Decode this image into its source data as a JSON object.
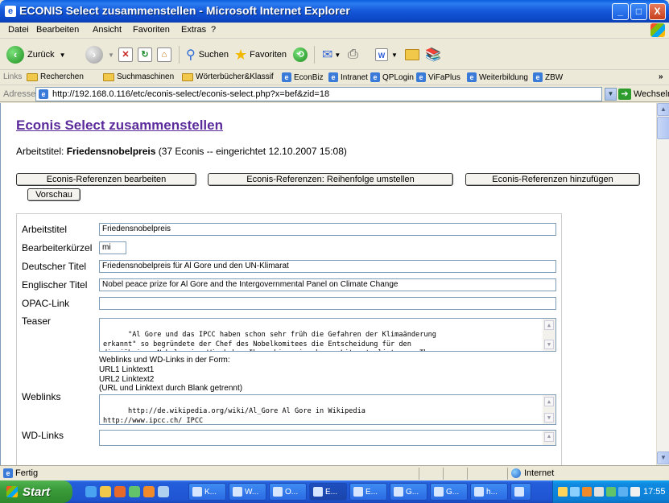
{
  "window": {
    "title": "ECONIS Select zusammenstellen - Microsoft Internet Explorer",
    "min": "_",
    "max": "□",
    "close": "X"
  },
  "menu": [
    "Datei",
    "Bearbeiten",
    "Ansicht",
    "Favoriten",
    "Extras",
    "?"
  ],
  "toolbar": {
    "back": "Zurück",
    "search": "Suchen",
    "favorites": "Favoriten"
  },
  "links": {
    "label": "Links",
    "items": [
      "Recherchen",
      "Suchmaschinen",
      "Wörterbücher&Klassif",
      "EconBiz",
      "Intranet",
      "QPLogin",
      "ViFaPlus",
      "Weiterbildung",
      "ZBW"
    ],
    "more": "»"
  },
  "address": {
    "label": "Adresse",
    "url": "http://192.168.0.116/etc/econis-select/econis-select.php?x=bef&zid=18",
    "go": "Wechseln zu"
  },
  "page": {
    "title": "Econis Select zusammenstellen",
    "worktitle_prefix": "Arbeitstitel: ",
    "worktitle_bold": "Friedensnobelpreis",
    "worktitle_suffix": " (37 Econis -- eingerichtet 12.10.2007 15:08)",
    "buttons": {
      "edit": "Econis-Referenzen bearbeiten",
      "reorder": "Econis-Referenzen: Reihenfolge umstellen",
      "add": "Econis-Referenzen hinzufügen",
      "preview": "Vorschau"
    }
  },
  "form": {
    "arbeitstitel_label": "Arbeitstitel",
    "arbeitstitel_value": "Friedensnobelpreis",
    "kuerzel_label": "Bearbeiterkürzel",
    "kuerzel_value": "mi",
    "de_title_label": "Deutscher Titel",
    "de_title_value": "Friedensnobelpreis für Al Gore und den UN-Klimarat",
    "en_title_label": "Englischer Titel",
    "en_title_value": "Nobel peace prize for Al Gore and the Intergovernmental Panel on Climate Change",
    "opac_label": "OPAC-Link",
    "opac_value": "",
    "teaser_label": "Teaser",
    "teaser_value": "\"Al Gore und das IPCC haben schon sehr früh die Gefahren der Klimaänderung\nerkannt\" so begründete der Chef des Nobelkomitees die Entscheidung für den\ndiesjährigen Nobelpreis. Wir haben Ihnen hier eine kurze Literaturliste zum Thema\naus der Datenbank ECONIS zusammengestellt:",
    "hint_lines": [
      "Weblinks und WD-Links in der Form:",
      "URL1 Linktext1",
      "URL2 Linktext2",
      "(URL und Linktext durch Blank getrennt)"
    ],
    "weblinks_label": "Weblinks",
    "weblinks_value": "http://de.wikipedia.org/wiki/Al_Gore Al Gore in Wikipedia\nhttp://www.ipcc.ch/ IPCC",
    "wdlinks_label": "WD-Links"
  },
  "status": {
    "left": "Fertig",
    "zone": "Internet"
  },
  "taskbar": {
    "start": "Start",
    "tasks": [
      "K...",
      "W...",
      "O...",
      "E...",
      "E...",
      "G...",
      "G...",
      "h..."
    ],
    "clock": "17:55"
  }
}
